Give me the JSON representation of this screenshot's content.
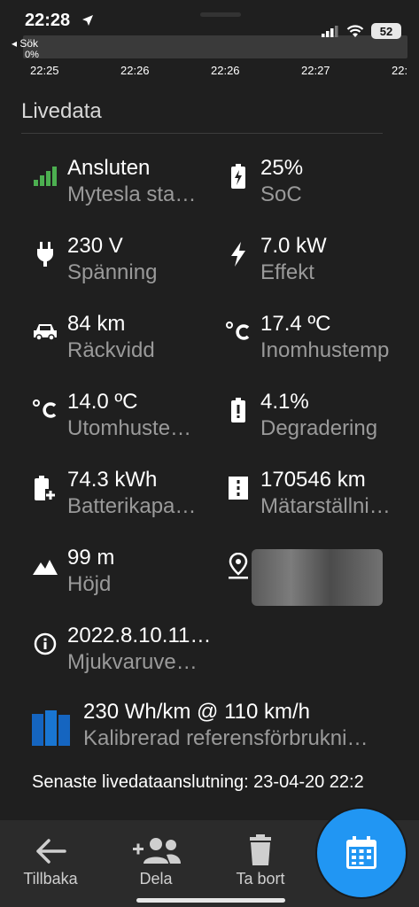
{
  "status": {
    "time": "22:28",
    "back_label": "◂ Sök",
    "battery": "52"
  },
  "chart_strip": {
    "percent": "0%",
    "ticks": [
      "22:25",
      "22:26",
      "22:26",
      "22:27",
      "22:"
    ]
  },
  "section_title": "Livedata",
  "items": [
    {
      "value": "Ansluten",
      "label": "Mytesla sta…",
      "icon": "signal-bars-icon"
    },
    {
      "value": "25%",
      "label": "SoC",
      "icon": "battery-charging-icon"
    },
    {
      "value": "230 V",
      "label": "Spänning",
      "icon": "plug-icon"
    },
    {
      "value": "7.0 kW",
      "label": "Effekt",
      "icon": "lightning-bolt-icon"
    },
    {
      "value": "84 km",
      "label": "Räckvidd",
      "icon": "car-icon"
    },
    {
      "value": "17.4 ºC",
      "label": "Inomhustemp",
      "icon": "celsius-icon"
    },
    {
      "value": "14.0 ºC",
      "label": "Utomhuste…",
      "icon": "celsius-icon"
    },
    {
      "value": "4.1%",
      "label": "Degradering",
      "icon": "battery-alert-icon"
    },
    {
      "value": "74.3 kWh",
      "label": "Batterikapa…",
      "icon": "battery-plus-icon"
    },
    {
      "value": "170546 km",
      "label": "Mätarställni…",
      "icon": "odometer-icon"
    },
    {
      "value": "99 m",
      "label": "Höjd",
      "icon": "terrain-icon"
    },
    {
      "value": "",
      "label": "",
      "icon": "map-pin-icon"
    },
    {
      "value": "2022.8.10.11…",
      "label": "Mjukvaruve…",
      "icon": "info-icon"
    }
  ],
  "calibration": {
    "value": "230 Wh/km @ 110 km/h",
    "label": "Kalibrerad referensförbrukni…",
    "icon": "bar-chart-icon"
  },
  "last_connection": "Senaste livedataanslutning: 23-04-20 22:2",
  "nav": {
    "back": "Tillbaka",
    "share": "Dela",
    "delete": "Ta bort"
  },
  "colors": {
    "background": "#1f1f1f",
    "accent": "#2196f3",
    "signal_green": "#4caf50",
    "muted_text": "#9a9a9a"
  }
}
